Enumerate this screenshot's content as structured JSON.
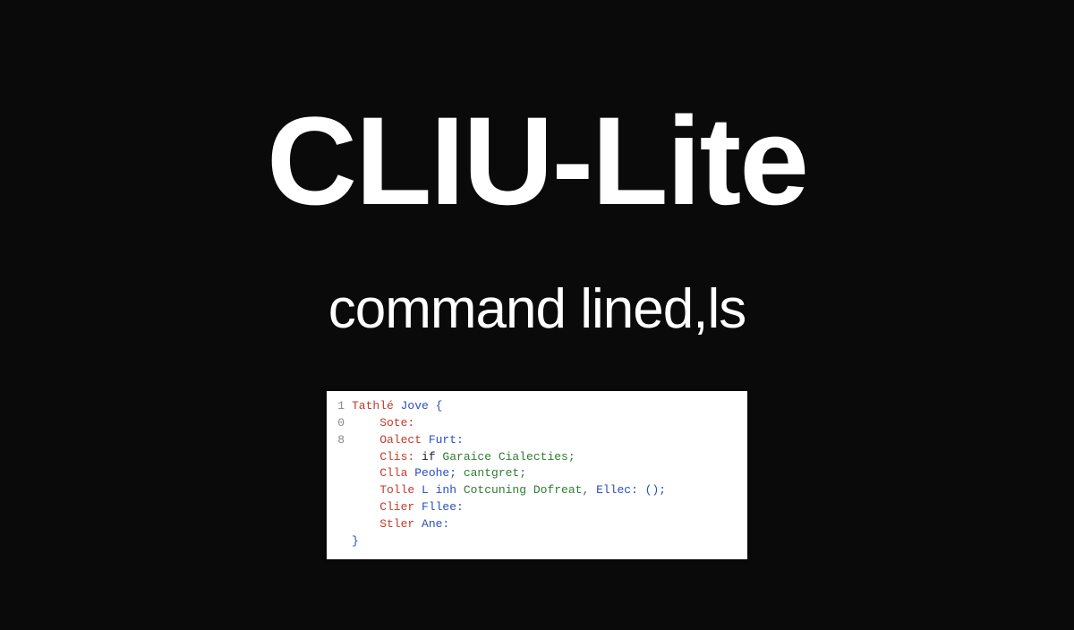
{
  "title": "CLIU-Lite",
  "subtitle": "command lined,ls",
  "code": {
    "lines": [
      {
        "num": "1",
        "segments": [
          {
            "text": "Tathlé ",
            "cls": "tok-red"
          },
          {
            "text": "Jove ",
            "cls": "tok-blue"
          },
          {
            "text": "{",
            "cls": "tok-blue"
          }
        ]
      },
      {
        "num": "0",
        "segments": [
          {
            "text": "    Sote:",
            "cls": "tok-red"
          }
        ]
      },
      {
        "num": "8",
        "segments": [
          {
            "text": "    Oalect ",
            "cls": "tok-red"
          },
          {
            "text": "Furt:",
            "cls": "tok-blue"
          }
        ]
      },
      {
        "num": "",
        "segments": [
          {
            "text": "    Clis: ",
            "cls": "tok-red"
          },
          {
            "text": "if ",
            "cls": "tok-black"
          },
          {
            "text": "Garaice Cialecties;",
            "cls": "tok-green"
          }
        ]
      },
      {
        "num": "",
        "segments": [
          {
            "text": "    Clla ",
            "cls": "tok-red"
          },
          {
            "text": "Peohe; ",
            "cls": "tok-blue"
          },
          {
            "text": "cantgret;",
            "cls": "tok-green"
          }
        ]
      },
      {
        "num": "",
        "segments": [
          {
            "text": "    Tolle ",
            "cls": "tok-red"
          },
          {
            "text": "L inh ",
            "cls": "tok-blue"
          },
          {
            "text": "Cotcuning ",
            "cls": "tok-green"
          },
          {
            "text": "Dofreat, ",
            "cls": "tok-green"
          },
          {
            "text": "Ellec: ();",
            "cls": "tok-blue"
          }
        ]
      },
      {
        "num": "",
        "segments": [
          {
            "text": "    Clier ",
            "cls": "tok-red"
          },
          {
            "text": "Fllee:",
            "cls": "tok-blue"
          }
        ]
      },
      {
        "num": "",
        "segments": [
          {
            "text": "    Stler ",
            "cls": "tok-red"
          },
          {
            "text": "Ane:",
            "cls": "tok-blue"
          }
        ]
      },
      {
        "num": "",
        "segments": [
          {
            "text": "}",
            "cls": "tok-blue"
          }
        ]
      }
    ]
  }
}
